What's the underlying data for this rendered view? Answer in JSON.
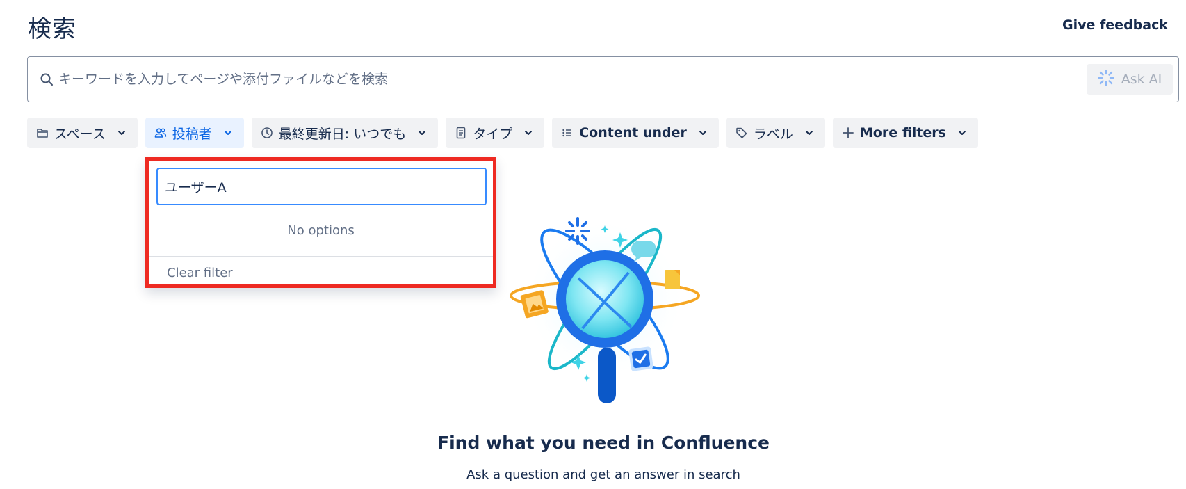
{
  "header": {
    "title": "検索",
    "feedback_label": "Give feedback"
  },
  "search": {
    "placeholder": "キーワードを入力してページや添付ファイルなどを検索",
    "value": "",
    "ask_ai_label": "Ask AI"
  },
  "filters": [
    {
      "label": "スペース",
      "icon": "folder-icon"
    },
    {
      "label": "投稿者",
      "icon": "people-icon",
      "active": true
    },
    {
      "label": "最終更新日: いつでも",
      "icon": "clock-icon"
    },
    {
      "label": "タイプ",
      "icon": "page-icon"
    },
    {
      "label": "Content under",
      "icon": "list-icon"
    },
    {
      "label": "ラベル",
      "icon": "tag-icon"
    },
    {
      "label": "More filters",
      "icon": "plus-icon"
    }
  ],
  "contributor_dropdown": {
    "input_value": "ユーザーA",
    "no_options": "No options",
    "clear_filter": "Clear filter"
  },
  "empty_state": {
    "title": "Find what you need in Confluence",
    "subtitle": "Ask a question and get an answer in search"
  },
  "colors": {
    "accent": "#0c66e4",
    "highlight_border": "#ee2a22",
    "chip_bg": "#f1f2f4",
    "text": "#172b4d"
  }
}
